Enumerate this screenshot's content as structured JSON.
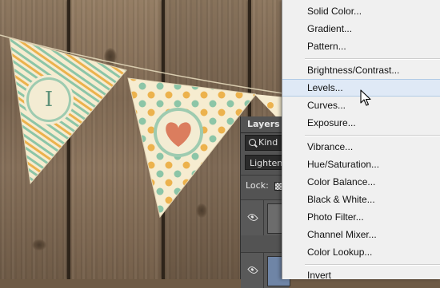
{
  "menu": {
    "items": [
      {
        "label": "Solid Color..."
      },
      {
        "label": "Gradient..."
      },
      {
        "label": "Pattern..."
      },
      {
        "label": "Brightness/Contrast..."
      },
      {
        "label": "Levels..."
      },
      {
        "label": "Curves..."
      },
      {
        "label": "Exposure..."
      },
      {
        "label": "Vibrance..."
      },
      {
        "label": "Hue/Saturation..."
      },
      {
        "label": "Color Balance..."
      },
      {
        "label": "Black & White..."
      },
      {
        "label": "Photo Filter..."
      },
      {
        "label": "Channel Mixer..."
      },
      {
        "label": "Color Lookup..."
      },
      {
        "label": "Invert"
      }
    ],
    "highlighted_item": "Levels...",
    "highlight_color": "#dfe9f6"
  },
  "layers_panel": {
    "tab_label": "Layers",
    "filter_label": "Kind",
    "blend_mode": "Lighten",
    "lock_label": "Lock:"
  },
  "canvas": {
    "emblem_letter": "I",
    "colors": {
      "flag_cream": "#f6ecd0",
      "stripe_green": "#8cc5a7",
      "stripe_orange": "#ecb24d",
      "heart": "#db7d5e",
      "wood": "#7e6953"
    }
  },
  "icons": [
    "search-icon",
    "eye-icon",
    "lock-icon",
    "heart-icon",
    "cursor-arrow-icon"
  ]
}
